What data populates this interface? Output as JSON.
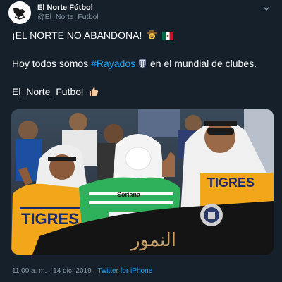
{
  "tweet": {
    "display_name": "El Norte Fútbol",
    "handle": "@El_Norte_Futbol",
    "line1": "¡EL NORTE NO ABANDONA!",
    "line2_before": "Hoy todos somos ",
    "hashtag": "#Rayados",
    "line2_after": " en el mundial de clubes.",
    "line3": "El_Norte_Futbol",
    "photo_banner_text": "النمور",
    "jersey_text_left": "TIGRES",
    "jersey_text_right": "TIGRES",
    "jersey_sponsor": "Soriana",
    "timestamp": "11:00 a. m. · 14 dic. 2019 · ",
    "source": "Twitter for iPhone"
  },
  "colors": {
    "background": "#15202b",
    "text": "#ffffff",
    "secondary": "#8899a6",
    "link": "#1da1f2",
    "tigres_yellow": "#f2a71b"
  },
  "icons": [
    "avatar-logo-icon",
    "chevron-down-icon",
    "cowboy-emoji-icon",
    "mexico-flag-emoji-icon",
    "soccer-ball-emoji-icon",
    "thumbs-up-emoji-icon"
  ]
}
